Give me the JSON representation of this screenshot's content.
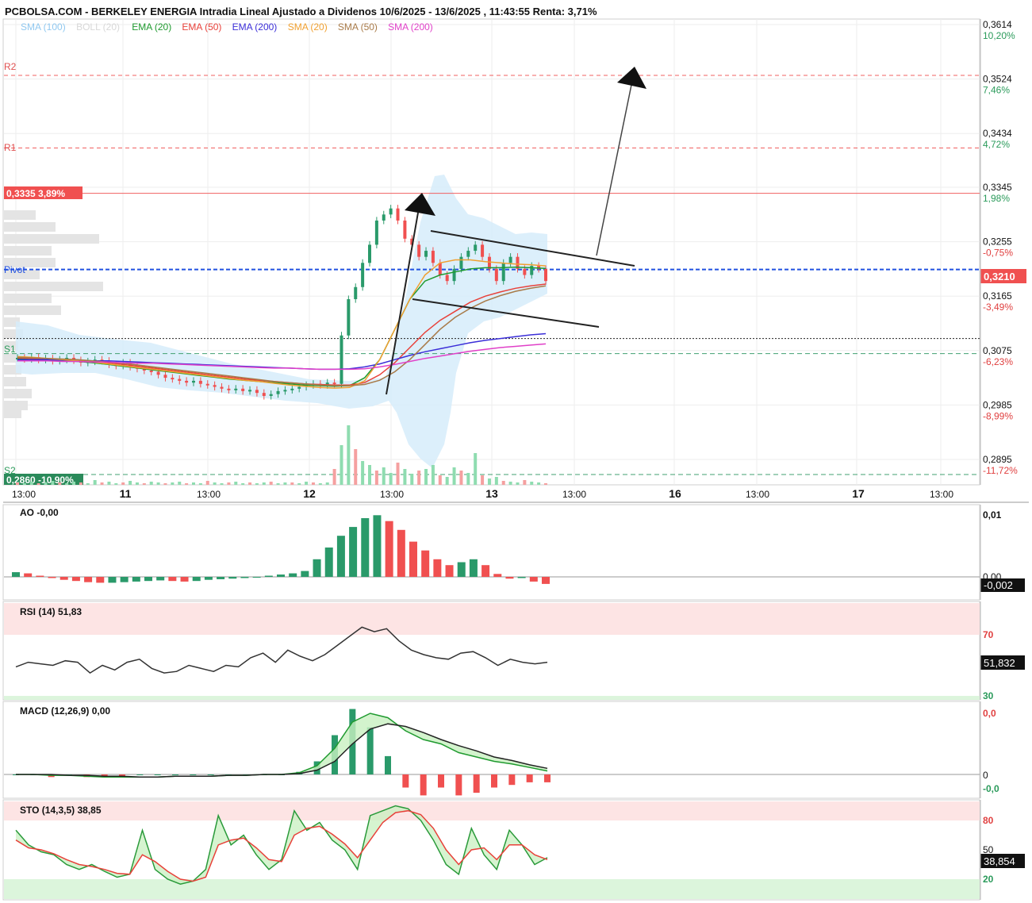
{
  "header": {
    "title": "PCBOLSA.COM - BERKELEY ENERGIA Intradia Lineal Ajustado a Dividenos 10/6/2025 - 13/6/2025 , 11:43:55 Renta: 3,71%"
  },
  "legend": [
    {
      "label": "SMA (100)",
      "color": "#90c8f0"
    },
    {
      "label": "BOLL (20)",
      "color": "#d8d8d8"
    },
    {
      "label": "EMA (20)",
      "color": "#1f9a2f"
    },
    {
      "label": "EMA (50)",
      "color": "#e8413a"
    },
    {
      "label": "EMA (200)",
      "color": "#3b2ed8"
    },
    {
      "label": "SMA (20)",
      "color": "#f0a030"
    },
    {
      "label": "SMA (50)",
      "color": "#a87a48"
    },
    {
      "label": "SMA (200)",
      "color": "#e040c8"
    }
  ],
  "levels": {
    "R2": "R2",
    "R1": "R1",
    "Pivot": "Pivot",
    "S1": "S1",
    "S2": "S2",
    "high_label": "0,3335  3,89%",
    "low_label": "0,2860 -10,90%",
    "last_price": "0,3210"
  },
  "price_axis": [
    {
      "price": "0,3614",
      "pct": "10,20%",
      "pct_color": "#2a9a5a"
    },
    {
      "price": "0,3524",
      "pct": "7,46%",
      "pct_color": "#2a9a5a"
    },
    {
      "price": "0,3434",
      "pct": "4,72%",
      "pct_color": "#2a9a5a"
    },
    {
      "price": "0,3345",
      "pct": "1,98%",
      "pct_color": "#2a9a5a"
    },
    {
      "price": "0,3255",
      "pct": "-0,75%",
      "pct_color": "#e04040"
    },
    {
      "price": "0,3165",
      "pct": "-3,49%",
      "pct_color": "#e04040"
    },
    {
      "price": "0,3075",
      "pct": "-6,23%",
      "pct_color": "#e04040"
    },
    {
      "price": "0,2985",
      "pct": "-8,99%",
      "pct_color": "#e04040"
    },
    {
      "price": "0,2895",
      "pct": "-11,72%",
      "pct_color": "#e04040"
    }
  ],
  "time_axis": [
    "13:00",
    "11",
    "13:00",
    "12",
    "13:00",
    "13",
    "13:00",
    "16",
    "13:00",
    "17",
    "13:00"
  ],
  "colors": {
    "up": "#2a9a6a",
    "down": "#f05050",
    "up_light": "#8fdcb0",
    "down_light": "#f5a0a0"
  },
  "indicators": {
    "ao": {
      "label": "AO  -0,00",
      "axis_top": "0,01",
      "axis_zero": "0,00",
      "value": "-0,002"
    },
    "rsi": {
      "label": "RSI (14)   51,83",
      "axis_70": "70",
      "axis_30": "30",
      "value": "51,832"
    },
    "macd": {
      "label": "MACD (12,26,9)   0,00",
      "axis_top": "0,0",
      "axis_zero": "0",
      "axis_bottom": "-0,0"
    },
    "sto": {
      "label": "STO (14,3,5)   38,85",
      "axis_80": "80",
      "axis_50": "50",
      "axis_20": "20",
      "value": "38,854"
    }
  },
  "chart_data": [
    {
      "type": "candlestick",
      "title": "PCBOLSA.COM - BERKELEY ENERGIA Intradia Lineal Ajustado a Dividenos 10/6/2025 - 13/6/2025 , 11:43:55 Renta: 3,71%",
      "x": "10/6/2025 - 13/6/2025 intraday",
      "ylim": [
        0.286,
        0.365
      ],
      "y_ticks": [
        0.3614,
        0.3524,
        0.3434,
        0.3345,
        0.3255,
        0.3165,
        0.3075,
        0.2985,
        0.2895
      ],
      "levels": {
        "R2": 0.353,
        "R1": 0.341,
        "Pivot": 0.3209,
        "S1": 0.307,
        "S2": 0.287,
        "last": 0.321,
        "high": 0.3335,
        "low": 0.286
      },
      "close_series": [
        0.3063,
        0.3061,
        0.3064,
        0.306,
        0.3062,
        0.3058,
        0.306,
        0.3063,
        0.3059,
        0.3055,
        0.3057,
        0.306,
        0.3058,
        0.3052,
        0.305,
        0.3055,
        0.3048,
        0.3045,
        0.3042,
        0.304,
        0.3035,
        0.303,
        0.3028,
        0.3025,
        0.3022,
        0.3025,
        0.302,
        0.3018,
        0.3015,
        0.3012,
        0.301,
        0.3012,
        0.3008,
        0.301,
        0.3005,
        0.3,
        0.3003,
        0.3008,
        0.301,
        0.3012,
        0.3015,
        0.3018,
        0.302,
        0.3018,
        0.3022,
        0.302,
        0.31,
        0.316,
        0.318,
        0.322,
        0.325,
        0.329,
        0.33,
        0.331,
        0.329,
        0.326,
        0.325,
        0.323,
        0.324,
        0.322,
        0.32,
        0.319,
        0.321,
        0.323,
        0.324,
        0.325,
        0.323,
        0.321,
        0.319,
        0.322,
        0.323,
        0.321,
        0.32,
        0.3215,
        0.321,
        0.319
      ],
      "series": [
        {
          "name": "EMA (20)",
          "values": [
            0.3062,
            0.306,
            0.3059,
            0.3058,
            0.3057,
            0.3055,
            0.3052,
            0.3049,
            0.3046,
            0.3043,
            0.304,
            0.3037,
            0.3034,
            0.3031,
            0.3028,
            0.3026,
            0.3024,
            0.3022,
            0.302,
            0.3018,
            0.3017,
            0.3016,
            0.3017,
            0.303,
            0.306,
            0.311,
            0.316,
            0.319,
            0.32,
            0.3205,
            0.321,
            0.3212,
            0.3212,
            0.3213,
            0.3212,
            0.3211
          ]
        },
        {
          "name": "EMA (50)",
          "values": [
            0.3063,
            0.3062,
            0.3061,
            0.306,
            0.3059,
            0.3057,
            0.3055,
            0.3052,
            0.3049,
            0.3046,
            0.3043,
            0.304,
            0.3037,
            0.3034,
            0.3031,
            0.3028,
            0.3026,
            0.3024,
            0.3022,
            0.302,
            0.3019,
            0.3018,
            0.3018,
            0.3022,
            0.3035,
            0.3055,
            0.308,
            0.3105,
            0.3125,
            0.314,
            0.3155,
            0.3165,
            0.3172,
            0.3178,
            0.3182,
            0.3185
          ]
        },
        {
          "name": "EMA (200)",
          "values": [
            0.306,
            0.306,
            0.306,
            0.3059,
            0.3059,
            0.3058,
            0.3058,
            0.3057,
            0.3056,
            0.3055,
            0.3054,
            0.3053,
            0.3052,
            0.3051,
            0.305,
            0.3049,
            0.3048,
            0.3047,
            0.3046,
            0.3045,
            0.3044,
            0.3044,
            0.3045,
            0.3048,
            0.3053,
            0.306,
            0.3067,
            0.3073,
            0.3078,
            0.3083,
            0.3088,
            0.3092,
            0.3095,
            0.3098,
            0.3101,
            0.3103
          ]
        },
        {
          "name": "SMA (20)",
          "values": [
            0.3065,
            0.3064,
            0.3062,
            0.306,
            0.3058,
            0.3056,
            0.3053,
            0.305,
            0.3047,
            0.3044,
            0.3041,
            0.3038,
            0.3035,
            0.3032,
            0.3029,
            0.3026,
            0.3024,
            0.3021,
            0.3018,
            0.3016,
            0.3014,
            0.3013,
            0.3014,
            0.3025,
            0.306,
            0.311,
            0.316,
            0.32,
            0.322,
            0.3225,
            0.3225,
            0.3222,
            0.322,
            0.3218,
            0.3217,
            0.3215
          ]
        },
        {
          "name": "SMA (50)",
          "values": [
            0.3064,
            0.3063,
            0.3062,
            0.3061,
            0.306,
            0.3058,
            0.3056,
            0.3054,
            0.3051,
            0.3048,
            0.3045,
            0.3042,
            0.3039,
            0.3036,
            0.3033,
            0.303,
            0.3027,
            0.3024,
            0.3022,
            0.302,
            0.3018,
            0.3017,
            0.3017,
            0.3019,
            0.3026,
            0.304,
            0.306,
            0.3085,
            0.311,
            0.313,
            0.3145,
            0.3157,
            0.3166,
            0.3173,
            0.3178,
            0.3182
          ]
        },
        {
          "name": "SMA (200)",
          "values": [
            0.3058,
            0.3058,
            0.3058,
            0.3057,
            0.3057,
            0.3056,
            0.3056,
            0.3055,
            0.3054,
            0.3054,
            0.3053,
            0.3052,
            0.3051,
            0.305,
            0.3049,
            0.3048,
            0.3047,
            0.3046,
            0.3046,
            0.3045,
            0.3044,
            0.3044,
            0.3044,
            0.3045,
            0.3048,
            0.3052,
            0.3057,
            0.3062,
            0.3066,
            0.307,
            0.3074,
            0.3077,
            0.308,
            0.3082,
            0.3084,
            0.3086
          ]
        }
      ]
    },
    {
      "type": "bar",
      "title": "AO",
      "values": [
        0.0008,
        0.0006,
        0.0002,
        -0.0002,
        -0.0005,
        -0.0007,
        -0.0009,
        -0.001,
        -0.001,
        -0.0009,
        -0.0008,
        -0.0007,
        -0.0006,
        -0.0007,
        -0.0008,
        -0.0007,
        -0.0005,
        -0.0004,
        -0.0003,
        -0.0002,
        -0.0001,
        0.0002,
        0.0004,
        0.0006,
        0.001,
        0.003,
        0.005,
        0.007,
        0.0085,
        0.01,
        0.0105,
        0.0095,
        0.008,
        0.006,
        0.0045,
        0.003,
        0.002,
        0.0025,
        0.003,
        0.002,
        0.0005,
        -0.0003,
        -0.0002,
        -0.0008,
        -0.0012
      ]
    },
    {
      "type": "line",
      "title": "RSI (14)",
      "ylim": [
        30,
        80
      ],
      "values": [
        49,
        52,
        51,
        50,
        53,
        52,
        45,
        50,
        47,
        52,
        54,
        48,
        45,
        46,
        50,
        48,
        46,
        50,
        49,
        55,
        58,
        52,
        60,
        56,
        53,
        57,
        63,
        69,
        75,
        72,
        74,
        66,
        60,
        57,
        55,
        54,
        58,
        59,
        55,
        50,
        54,
        52,
        51,
        52
      ]
    },
    {
      "type": "line",
      "title": "MACD (12,26,9)",
      "series": [
        {
          "name": "MACD",
          "values": [
            0.0,
            0.0,
            -0.0001,
            -0.0001,
            -0.0002,
            -0.0003,
            -0.0003,
            -0.0003,
            -0.0003,
            -0.0002,
            -0.0002,
            -0.0002,
            -0.0001,
            -0.0001,
            0.0,
            0.0,
            0.0002,
            0.001,
            0.003,
            0.006,
            0.007,
            0.0065,
            0.005,
            0.004,
            0.0035,
            0.0025,
            0.002,
            0.0015,
            0.0012,
            0.0008,
            0.0004
          ]
        },
        {
          "name": "Signal",
          "values": [
            0.0,
            0.0,
            0.0,
            -0.0001,
            -0.0001,
            -0.0002,
            -0.0002,
            -0.0003,
            -0.0003,
            -0.0002,
            -0.0002,
            -0.0002,
            -0.0001,
            -0.0001,
            0.0,
            0.0,
            0.0001,
            0.0005,
            0.0015,
            0.0035,
            0.0052,
            0.0058,
            0.0055,
            0.0048,
            0.004,
            0.0033,
            0.0027,
            0.002,
            0.0016,
            0.0011,
            0.0007
          ]
        }
      ]
    },
    {
      "type": "line",
      "title": "STO (14,3,5)",
      "ylim": [
        0,
        100
      ],
      "series": [
        {
          "name": "%K",
          "values": [
            70,
            55,
            48,
            45,
            35,
            30,
            35,
            28,
            22,
            25,
            70,
            30,
            20,
            15,
            18,
            30,
            85,
            55,
            65,
            45,
            30,
            40,
            90,
            70,
            78,
            60,
            50,
            30,
            85,
            90,
            95,
            92,
            80,
            60,
            35,
            25,
            72,
            45,
            30,
            70,
            55,
            35,
            42
          ]
        },
        {
          "name": "%D",
          "values": [
            60,
            52,
            50,
            46,
            40,
            35,
            33,
            30,
            26,
            25,
            45,
            38,
            28,
            20,
            18,
            22,
            55,
            60,
            62,
            52,
            40,
            38,
            65,
            72,
            74,
            66,
            56,
            42,
            60,
            78,
            88,
            90,
            86,
            72,
            50,
            35,
            50,
            52,
            40,
            55,
            55,
            45,
            40
          ]
        }
      ]
    }
  ]
}
